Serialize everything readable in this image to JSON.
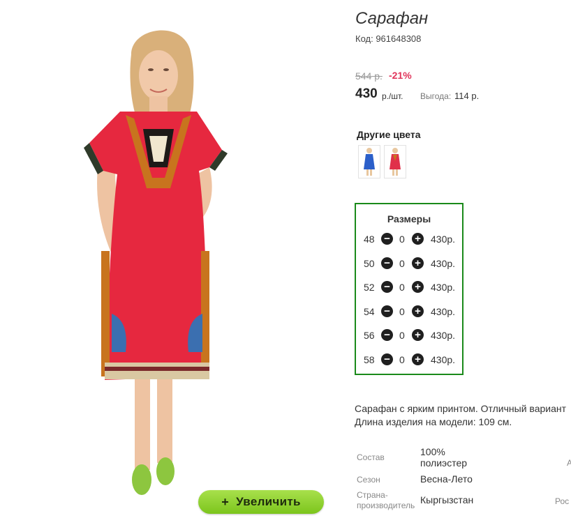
{
  "product": {
    "title": "Сарафан",
    "code": "Код: 961648308",
    "old_price": "544 р.",
    "discount": "-21%",
    "price": "430",
    "price_unit": "р./шт.",
    "benefit_label": "Выгода:",
    "benefit_value": "114 р."
  },
  "zoom_button": {
    "icon": "plus-icon",
    "label": "Увеличить"
  },
  "other_colors": {
    "title": "Другие цвета",
    "swatches": [
      {
        "name": "blue-dress",
        "color": "#2b5fc9"
      },
      {
        "name": "red-dress",
        "color": "#e0304a"
      }
    ]
  },
  "sizes": {
    "title": "Размеры",
    "rows": [
      {
        "size": "48",
        "qty": "0",
        "price": "430р."
      },
      {
        "size": "50",
        "qty": "0",
        "price": "430р."
      },
      {
        "size": "52",
        "qty": "0",
        "price": "430р."
      },
      {
        "size": "54",
        "qty": "0",
        "price": "430р."
      },
      {
        "size": "56",
        "qty": "0",
        "price": "430р."
      },
      {
        "size": "58",
        "qty": "0",
        "price": "430р."
      }
    ],
    "minus_icon": "minus-circle-icon",
    "plus_icon": "plus-circle-icon"
  },
  "description": {
    "line1": "Сарафан с ярким принтом. Отличный вариант",
    "line2": "Длина изделия на модели: 109 см."
  },
  "specs": [
    {
      "label": "Состав",
      "value": "100% полиэстер"
    },
    {
      "label": "Сезон",
      "value": "Весна-Лето"
    },
    {
      "label": "Страна-производитель",
      "value": "Кыргызстан"
    }
  ],
  "cut_off": {
    "right_mark": "А",
    "right_label": "Рос"
  },
  "colors": {
    "accent_green": "#1a8a1a",
    "discount_red": "#e0345a",
    "button_green": "#8fd13a"
  }
}
